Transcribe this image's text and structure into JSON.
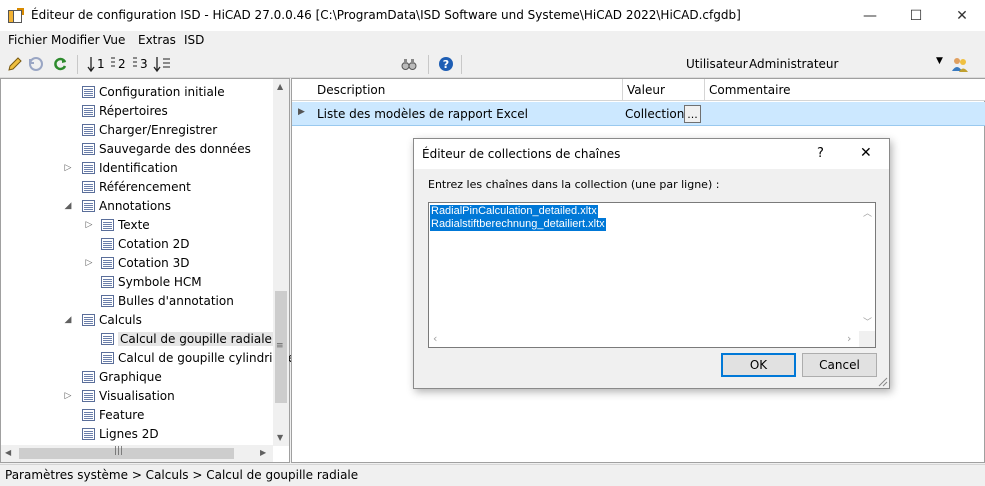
{
  "window": {
    "title": "Éditeur de configuration ISD  - HiCAD 27.0.0.46 [C:\\ProgramData\\ISD Software und Systeme\\HiCAD 2022\\HiCAD.cfgdb]",
    "minimize": "—",
    "maximize": "☐",
    "close": "✕"
  },
  "menu": [
    "Fichier",
    "Modifier",
    "Vue",
    "Extras",
    "ISD"
  ],
  "toolbar": {
    "user_label": "Utilisateur",
    "user_value": "Administrateur",
    "tool_icons": [
      "pencil-icon",
      "undo-icon",
      "refresh-icon",
      "sort-1-icon",
      "sort-2-icon",
      "sort-3-icon",
      "sort-order-icon",
      "binoculars-icon",
      "help-icon",
      "users-icon"
    ],
    "sort_labels": [
      "1",
      "2",
      "3"
    ]
  },
  "tree": [
    {
      "label": "Configuration initiale",
      "level": 1,
      "toggle": ""
    },
    {
      "label": "Répertoires",
      "level": 1,
      "toggle": ""
    },
    {
      "label": "Charger/Enregistrer",
      "level": 1,
      "toggle": ""
    },
    {
      "label": "Sauvegarde des données",
      "level": 1,
      "toggle": ""
    },
    {
      "label": "Identification",
      "level": 1,
      "toggle": "▷"
    },
    {
      "label": "Référencement",
      "level": 1,
      "toggle": ""
    },
    {
      "label": "Annotations",
      "level": 1,
      "toggle": "◢"
    },
    {
      "label": "Texte",
      "level": 2,
      "toggle": "▷"
    },
    {
      "label": "Cotation 2D",
      "level": 2,
      "toggle": ""
    },
    {
      "label": "Cotation 3D",
      "level": 2,
      "toggle": "▷"
    },
    {
      "label": "Symbole HCM",
      "level": 2,
      "toggle": ""
    },
    {
      "label": "Bulles d'annotation",
      "level": 2,
      "toggle": ""
    },
    {
      "label": "Calculs",
      "level": 1,
      "toggle": "◢"
    },
    {
      "label": "Calcul de goupille radiale",
      "level": 2,
      "toggle": "",
      "selected": true
    },
    {
      "label": "Calcul de goupille cylindrique",
      "level": 2,
      "toggle": ""
    },
    {
      "label": "Graphique",
      "level": 1,
      "toggle": ""
    },
    {
      "label": "Visualisation",
      "level": 1,
      "toggle": "▷"
    },
    {
      "label": "Feature",
      "level": 1,
      "toggle": ""
    },
    {
      "label": "Lignes 2D",
      "level": 1,
      "toggle": ""
    }
  ],
  "grid": {
    "columns": [
      "Description",
      "Valeur",
      "Commentaire"
    ],
    "rows": [
      {
        "description": "Liste des modèles de rapport Excel",
        "value": "Collection",
        "button": "...",
        "comment": ""
      }
    ]
  },
  "status": "Paramètres système > Calculs > Calcul de goupille radiale",
  "dialog": {
    "title": "Éditeur de collections de chaînes",
    "help": "?",
    "close": "✕",
    "prompt": "Entrez les chaînes dans la collection (une par ligne) :",
    "lines": [
      "RadialPinCalculation_detailed.xltx",
      "Radialstiftberechnung_detailiert.xltx"
    ],
    "ok": "OK",
    "cancel": "Cancel"
  },
  "colors": {
    "selection": "#cce8ff",
    "text_selection": "#0078d7",
    "accent": "#0078d7"
  }
}
